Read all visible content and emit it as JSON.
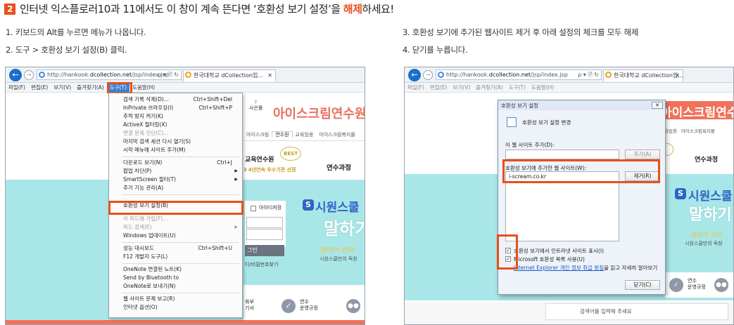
{
  "title": {
    "step_number": "2",
    "text_before": "인터넷 익스플로러10과 11에서도 이 창이 계속 뜬다면 ‘호환성 보기 설정’을 ",
    "highlight": "해제",
    "text_after": "하세요!"
  },
  "steps_left": [
    "1. 키보드의 Alt를 누르면 메뉴가 나옵니다.",
    "2. 도구 > 호환성 보기 설정(B) 클릭."
  ],
  "steps_right": [
    "3. 호환성 보기에 추가된 웹사이트 제거 후 아래 설정의 체크를 모두 해제",
    "4. 닫기를 누릅니다."
  ],
  "browser": {
    "back_glyph": "←",
    "forward_glyph": "→",
    "address_prefix": "http://hankook.",
    "address_domain": "dcollection.net",
    "address_path": "/jsp/index.jsp",
    "address_controls": "ρ ▾ 🗎 ↻",
    "tab_title": "한국대학교 dCollection입...",
    "tab_close": "✕"
  },
  "menubar": [
    "파일(F)",
    "편집(E)",
    "보기(V)",
    "즐겨찾기(A)",
    "도구(T)",
    "도움말(H)"
  ],
  "tools_menu": [
    {
      "label": "검색 기록 삭제(D)...",
      "shortcut": "Ctrl+Shift+Del"
    },
    {
      "label": "InPrivate 브라우징(I)",
      "shortcut": "Ctrl+Shift+P"
    },
    {
      "label": "추적 방지 켜기(K)",
      "shortcut": ""
    },
    {
      "label": "ActiveX 필터링(X)",
      "shortcut": ""
    },
    {
      "label": "연결 문제 진단(C)...",
      "shortcut": "",
      "disabled": true
    },
    {
      "label": "마지막 검색 세션 다시 열기(S)",
      "shortcut": ""
    },
    {
      "label": "시작 메뉴에 사이트 추가(M)",
      "shortcut": ""
    },
    {
      "label": "다운로드 보기(N)",
      "shortcut": "Ctrl+J"
    },
    {
      "label": "팝업 차단(P)",
      "shortcut": "",
      "submenu": true
    },
    {
      "label": "SmartScreen 필터(T)",
      "shortcut": "",
      "submenu": true
    },
    {
      "label": "추가 기능 관리(A)",
      "shortcut": ""
    },
    {
      "label": "호환성 보기 설정(B)",
      "shortcut": ""
    },
    {
      "label": "이 피드에 가입(F)...",
      "shortcut": "",
      "disabled": true
    },
    {
      "label": "피드 검색(E)",
      "shortcut": "",
      "disabled": true,
      "submenu": true
    },
    {
      "label": "Windows 업데이트(U)",
      "shortcut": ""
    },
    {
      "label": "성능 대시보드",
      "shortcut": "Ctrl+Shift+U"
    },
    {
      "label": "F12 개발자 도구(L)",
      "shortcut": ""
    },
    {
      "label": "OneNote 연결된 노트(K)",
      "shortcut": ""
    },
    {
      "label": "Send by Bluetooth to",
      "shortcut": ""
    },
    {
      "label": "OneNote로 보내기(N)",
      "shortcut": ""
    },
    {
      "label": "웹 사이트 문제 보고(R)",
      "shortcut": ""
    },
    {
      "label": "인터넷 옵션(O)",
      "shortcut": ""
    }
  ],
  "site": {
    "gift_top": "T",
    "gift_bottom": "사은품",
    "brand": "아이스크림연수원",
    "nav": [
      "아이스크림",
      "연수원",
      "교육임용",
      "아이스크림복지몰"
    ],
    "org": "교육연수원",
    "best_badge": "BEST",
    "award_prefix": "3",
    "award": "4년연속 우수기관 선정",
    "course": "연수과정",
    "save_id": "아이디저장",
    "login_button": "그인",
    "find_link": "디/비밀번호찾기",
    "banner_logo": "S",
    "banner_title": "시원스쿨",
    "banner_sub": "말하기",
    "banner_script": "영어가 안되",
    "banner_note": "시원스쿨만의 독창",
    "icon1_label": "연수\n운영규정",
    "icon_left_label": "육부\n기서",
    "search_placeholder": "검색어를 입력해 주세요"
  },
  "dialog": {
    "title": "호환성 보기 설정",
    "close": "✕",
    "header": "호환성 보기 설정 변경",
    "add_label": "이 웹 사이트 추가(D):",
    "add_button": "추가(A)",
    "list_label": "호환성 보기에 추가한 웹 사이트(W):",
    "list_item": "i-scream.co.kr",
    "remove_button": "제거(R)",
    "check1": "호환성 보기에서 인트라넷 사이트 표시(I)",
    "check2": "Microsoft 호환성 목록 사용(U)",
    "privacy_link": "Internet Explorer 개인 정보 취급 방침",
    "privacy_suffix": "을 읽고 자세히 알아보기",
    "close_button": "닫기(C)"
  }
}
